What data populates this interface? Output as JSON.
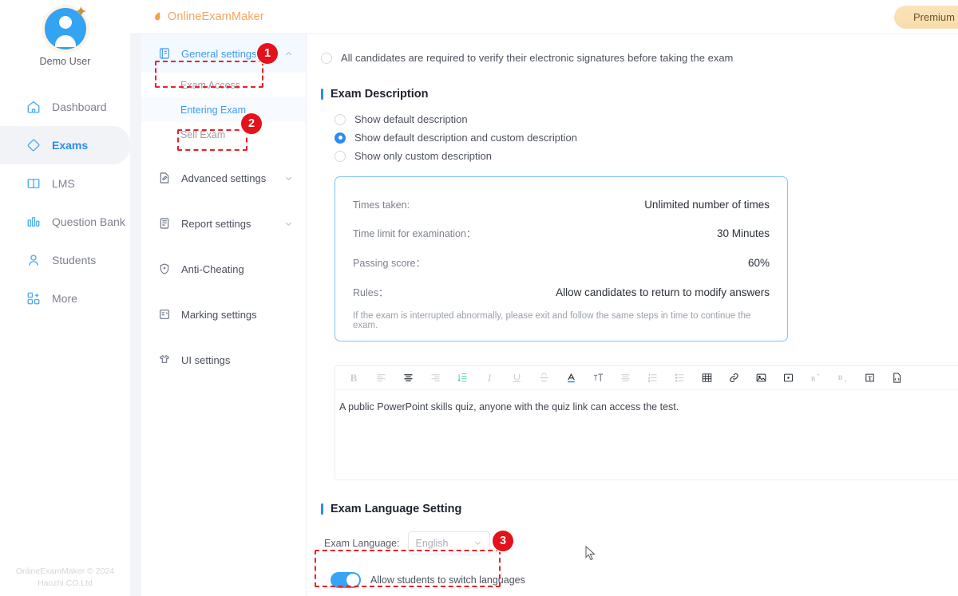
{
  "brand": {
    "logo_text": "OnlineExamMaker",
    "logo_color": "#f6a55c",
    "accent_color": "#2b8bf2",
    "annotation_color": "#e3121b"
  },
  "topbar": {
    "premium_label": "Premium"
  },
  "rail": {
    "username": "Demo User",
    "items": [
      {
        "label": "Dashboard",
        "icon": "home-icon",
        "active": false
      },
      {
        "label": "Exams",
        "icon": "exam-tag-icon",
        "active": true
      },
      {
        "label": "LMS",
        "icon": "book-open-icon",
        "active": false
      },
      {
        "label": "Question Bank",
        "icon": "bar-chart-icon",
        "active": false
      },
      {
        "label": "Students",
        "icon": "user-icon",
        "active": false
      },
      {
        "label": "More",
        "icon": "grid-more-icon",
        "active": false
      }
    ],
    "footer_line1": "OnlineExamMaker © 2024",
    "footer_line2": "Haozhi CO.Ltd"
  },
  "settings_panel": {
    "groups": [
      {
        "label": "General settings",
        "icon": "book-settings-icon",
        "expanded": true,
        "chevron": "chevron-up-icon",
        "children": [
          {
            "label": "Exam Access",
            "selected": false
          },
          {
            "label": "Entering Exam",
            "selected": true
          },
          {
            "label": "Sell Exam",
            "selected": false
          }
        ]
      },
      {
        "label": "Advanced settings",
        "icon": "doc-pencil-icon",
        "expanded": false,
        "chevron": "chevron-down-icon",
        "children": []
      },
      {
        "label": "Report settings",
        "icon": "report-doc-icon",
        "expanded": false,
        "chevron": "chevron-down-icon",
        "children": []
      },
      {
        "label": "Anti-Cheating",
        "icon": "shield-plus-icon",
        "expanded": false,
        "chevron": "",
        "children": []
      },
      {
        "label": "Marking settings",
        "icon": "marking-doc-icon",
        "expanded": false,
        "chevron": "",
        "children": []
      },
      {
        "label": "UI settings",
        "icon": "tshirt-icon",
        "expanded": false,
        "chevron": "",
        "children": []
      }
    ]
  },
  "main": {
    "signature_option": {
      "label": "All candidates are required to verify their electronic signatures before taking the exam",
      "checked": false
    },
    "exam_description": {
      "section_title": "Exam Description",
      "options": [
        {
          "label": "Show default description",
          "checked": false
        },
        {
          "label": "Show default description and custom description",
          "checked": true
        },
        {
          "label": "Show only custom description",
          "checked": false
        }
      ],
      "info_card": {
        "rows": [
          {
            "key": "Times taken:",
            "value": "Unlimited number of times"
          },
          {
            "key": "Time limit for examination：",
            "value": "30 Minutes"
          },
          {
            "key": "Passing score：",
            "value": "60%"
          },
          {
            "key": "Rules：",
            "value": "Allow candidates to return to modify answers"
          }
        ],
        "note": "If the exam is interrupted abnormally, please exit and follow the same steps in time to continue the exam."
      }
    },
    "editor": {
      "toolbar": [
        {
          "name": "bold-icon",
          "label": "B",
          "state": "light"
        },
        {
          "name": "align-left-icon",
          "label": "",
          "state": "light"
        },
        {
          "name": "align-center-icon",
          "label": "",
          "state": "dark"
        },
        {
          "name": "align-right-icon",
          "label": "",
          "state": "light"
        },
        {
          "name": "line-height-icon",
          "label": "",
          "state": "teal"
        },
        {
          "name": "italic-icon",
          "label": "I",
          "state": "light"
        },
        {
          "name": "underline-icon",
          "label": "U",
          "state": "light"
        },
        {
          "name": "strikethrough-icon",
          "label": "S",
          "state": "light"
        },
        {
          "name": "font-color-icon",
          "label": "A",
          "state": "dark"
        },
        {
          "name": "font-size-icon",
          "label": "T",
          "state": "mid"
        },
        {
          "name": "justify-icon",
          "label": "",
          "state": "light"
        },
        {
          "name": "ordered-list-icon",
          "label": "",
          "state": "light"
        },
        {
          "name": "bullet-list-icon",
          "label": "",
          "state": "light"
        },
        {
          "name": "table-icon",
          "label": "",
          "state": "dark"
        },
        {
          "name": "link-icon",
          "label": "",
          "state": "dark"
        },
        {
          "name": "image-icon",
          "label": "",
          "state": "dark"
        },
        {
          "name": "video-icon",
          "label": "",
          "state": "dark"
        },
        {
          "name": "superscript-icon",
          "label": "",
          "state": "light"
        },
        {
          "name": "subscript-icon",
          "label": "",
          "state": "light"
        },
        {
          "name": "text-box-icon",
          "label": "T",
          "state": "dark"
        },
        {
          "name": "source-code-icon",
          "label": "",
          "state": "dark"
        }
      ],
      "content": "A public PowerPoint skills quiz, anyone with the quiz link can access the test."
    },
    "language_setting": {
      "section_title": "Exam Language Setting",
      "field_label": "Exam Language:",
      "selected_value": "English",
      "options": [
        "English"
      ],
      "switch_label": "Allow students to switch languages",
      "switch_on": true
    }
  },
  "annotations": {
    "steps": [
      {
        "number": "1",
        "target": "general-settings-group"
      },
      {
        "number": "2",
        "target": "entering-exam-subitem"
      },
      {
        "number": "3",
        "target": "switch-languages-toggle"
      }
    ]
  }
}
